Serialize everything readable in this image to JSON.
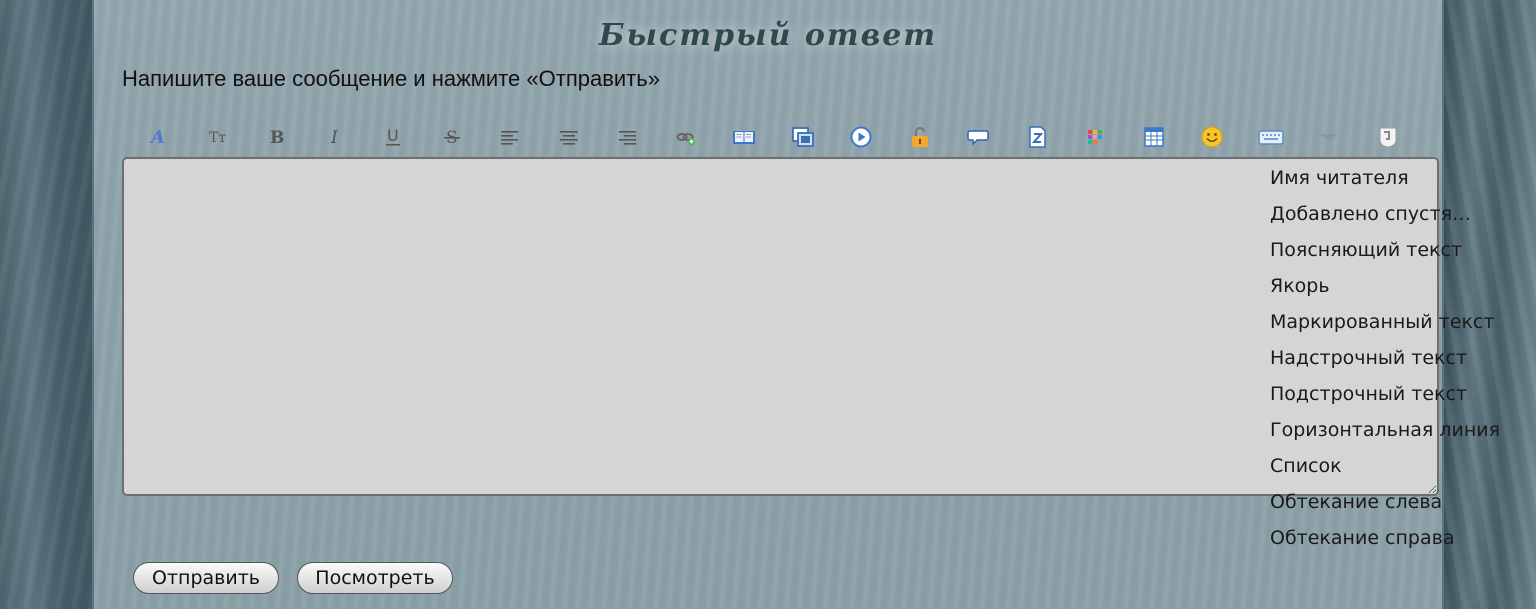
{
  "form": {
    "title": "Быстрый ответ",
    "instruction": "Напишите ваше сообщение и нажмите «Отправить»"
  },
  "toolbar": {
    "icons": [
      "font-face-icon",
      "font-size-icon",
      "bold-icon",
      "italic-icon",
      "underline-icon",
      "strikethrough-icon",
      "align-left-icon",
      "align-center-icon",
      "align-right-icon",
      "link-icon",
      "image-icon",
      "video-icon",
      "play-icon",
      "spoiler-icon",
      "quote-icon",
      "code-icon",
      "color-icon",
      "table-icon",
      "smiley-icon",
      "keyboard-icon",
      "more-dropdown-icon",
      "skype-icon"
    ]
  },
  "editor": {
    "value": ""
  },
  "more_menu": {
    "items": [
      "Имя читателя",
      "Добавлено спустя…",
      "Поясняющий текст",
      "Якорь",
      "Маркированный текст",
      "Надстрочный текст",
      "Подстрочный текст",
      "Горизонтальная линия",
      "Список",
      "Обтекание слева",
      "Обтекание справа"
    ]
  },
  "buttons": {
    "submit_label": "Отправить",
    "preview_label": "Посмотреть"
  },
  "colors": {
    "title": "#2f4a4c",
    "editor_bg": "#d5d5d5",
    "panel_bg": "#8ea2aa"
  }
}
